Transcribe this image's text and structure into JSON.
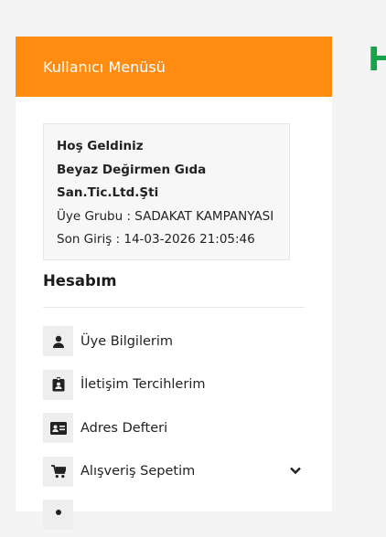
{
  "header": {
    "title": "Kullanıcı Menüsü"
  },
  "partial_heading": "H",
  "welcome": {
    "greeting": "Hoş Geldiniz",
    "company_line1": "Beyaz Değirmen Gıda",
    "company_line2": "San.Tic.Ltd.Şti",
    "group": "Üye Grubu : SADAKAT KAMPANYASI",
    "last_login": "Son Giriş : 14-03-2026 21:05:46"
  },
  "section": {
    "title": "Hesabım"
  },
  "menu": {
    "items": [
      {
        "label": "Üye Bilgilerim",
        "icon": "user-icon"
      },
      {
        "label": "İletişim Tercihlerim",
        "icon": "id-badge-icon"
      },
      {
        "label": "Adres Defteri",
        "icon": "address-card-icon"
      },
      {
        "label": "Alışveriş Sepetim",
        "icon": "cart-icon",
        "expandable": true
      },
      {
        "label": "",
        "icon": "partial-icon"
      }
    ]
  },
  "colors": {
    "accent": "#ff8c10",
    "heading_green": "#18a34a",
    "icon_bg": "#eeeeee"
  }
}
